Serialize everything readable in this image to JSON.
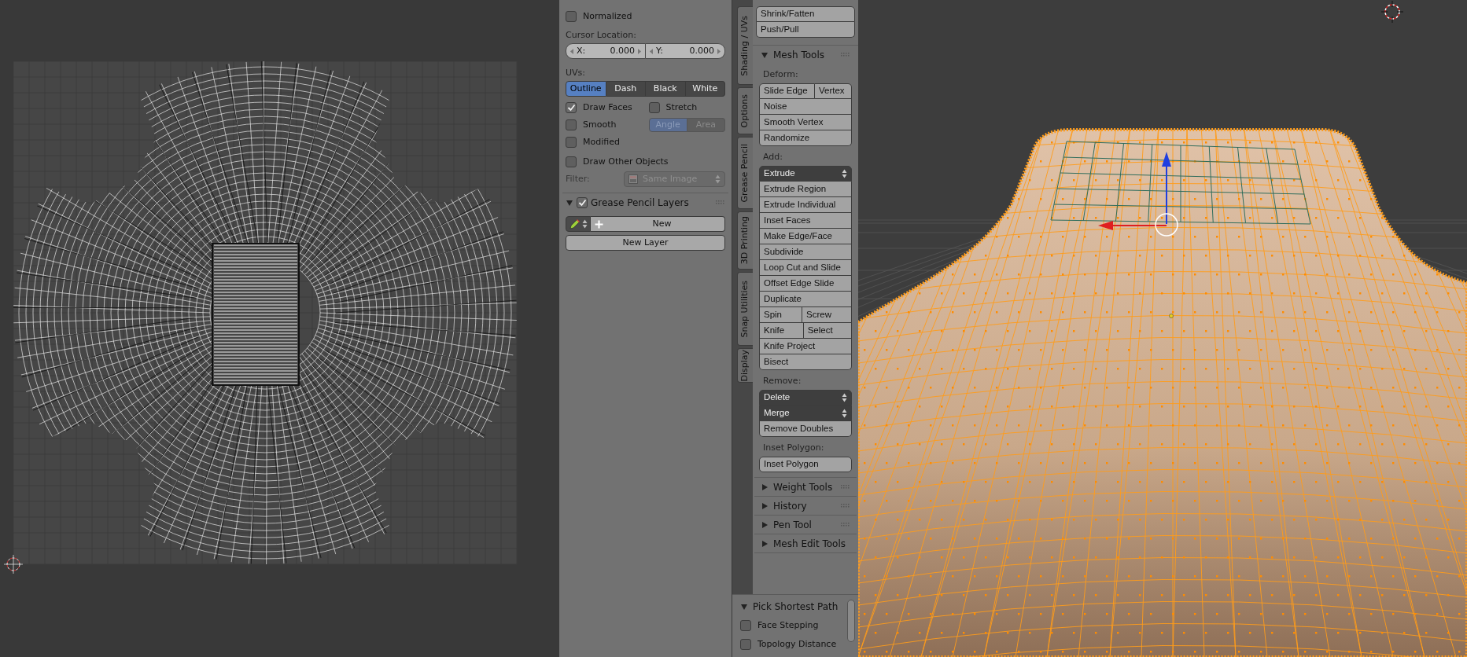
{
  "properties": {
    "normalized": {
      "label": "Normalized",
      "checked": false
    },
    "cursor_location": {
      "label": "Cursor Location:",
      "fields": [
        {
          "label": "X:",
          "value": "0.000"
        },
        {
          "label": "Y:",
          "value": "0.000"
        }
      ]
    },
    "uvs": {
      "label": "UVs:",
      "options": [
        {
          "label": "Outline",
          "selected": true
        },
        {
          "label": "Dash",
          "selected": false
        },
        {
          "label": "Black",
          "selected": false
        },
        {
          "label": "White",
          "selected": false
        }
      ]
    },
    "draw_faces": {
      "label": "Draw Faces",
      "checked": true
    },
    "stretch": {
      "label": "Stretch",
      "checked": false
    },
    "smooth": {
      "label": "Smooth",
      "checked": false
    },
    "stretch_mode": {
      "disabled": true,
      "options": [
        {
          "label": "Angle",
          "selected": true
        },
        {
          "label": "Area",
          "selected": false
        }
      ]
    },
    "modified": {
      "label": "Modified",
      "checked": false
    },
    "draw_other_objects": {
      "label": "Draw Other Objects",
      "checked": false
    },
    "filter": {
      "label": "Filter:",
      "value": "Same Image",
      "disabled": true
    },
    "grease_pencil_layers": {
      "title": "Grease Pencil Layers",
      "expanded": true,
      "checked": true,
      "new_button": "New",
      "new_layer_button": "New Layer"
    }
  },
  "tool_tabs": [
    {
      "label": "Shading / UVs"
    },
    {
      "label": "Options"
    },
    {
      "label": "Grease Pencil"
    },
    {
      "label": "3D Printing"
    },
    {
      "label": "Snap Utilities"
    },
    {
      "label": "Display"
    }
  ],
  "tool_shelf": {
    "top_buttons": [
      "Shrink/Fatten",
      "Push/Pull"
    ],
    "panels": [
      {
        "title": "Mesh Tools",
        "expanded": true,
        "groups": [
          {
            "label": "Deform:",
            "rows": [
              [
                {
                  "kind": "button",
                  "label": "Slide Edge"
                },
                {
                  "kind": "button",
                  "label": "Vertex"
                }
              ],
              [
                {
                  "kind": "button",
                  "label": "Noise"
                }
              ],
              [
                {
                  "kind": "button",
                  "label": "Smooth Vertex"
                }
              ],
              [
                {
                  "kind": "button",
                  "label": "Randomize"
                }
              ]
            ]
          },
          {
            "label": "Add:",
            "rows": [
              [
                {
                  "kind": "dropdown",
                  "label": "Extrude"
                }
              ],
              [
                {
                  "kind": "button",
                  "label": "Extrude Region"
                }
              ],
              [
                {
                  "kind": "button",
                  "label": "Extrude Individual"
                }
              ],
              [
                {
                  "kind": "button",
                  "label": "Inset Faces"
                }
              ],
              [
                {
                  "kind": "button",
                  "label": "Make Edge/Face"
                }
              ],
              [
                {
                  "kind": "button",
                  "label": "Subdivide"
                }
              ],
              [
                {
                  "kind": "button",
                  "label": "Loop Cut and Slide"
                }
              ],
              [
                {
                  "kind": "button",
                  "label": "Offset Edge Slide"
                }
              ],
              [
                {
                  "kind": "button",
                  "label": "Duplicate"
                }
              ],
              [
                {
                  "kind": "button",
                  "label": "Spin"
                },
                {
                  "kind": "button",
                  "label": "Screw"
                }
              ],
              [
                {
                  "kind": "button",
                  "label": "Knife"
                },
                {
                  "kind": "button",
                  "label": "Select"
                }
              ],
              [
                {
                  "kind": "button",
                  "label": "Knife Project"
                }
              ],
              [
                {
                  "kind": "button",
                  "label": "Bisect"
                }
              ]
            ]
          },
          {
            "label": "Remove:",
            "rows": [
              [
                {
                  "kind": "dropdown",
                  "label": "Delete"
                }
              ],
              [
                {
                  "kind": "dropdown",
                  "label": "Merge"
                }
              ],
              [
                {
                  "kind": "button",
                  "label": "Remove Doubles"
                }
              ]
            ]
          },
          {
            "label": "Inset Polygon:",
            "rows": [
              [
                {
                  "kind": "button",
                  "label": "Inset Polygon"
                }
              ]
            ]
          }
        ]
      },
      {
        "title": "Weight Tools",
        "expanded": false
      },
      {
        "title": "History",
        "expanded": false
      },
      {
        "title": "Pen Tool",
        "expanded": false
      },
      {
        "title": "Mesh Edit Tools",
        "expanded": false
      }
    ]
  },
  "pick_shortest_path": {
    "title": "Pick Shortest Path",
    "expanded": true,
    "options": [
      {
        "label": "Face Stepping",
        "checked": false
      },
      {
        "label": "Topology Distance",
        "checked": false
      }
    ]
  }
}
